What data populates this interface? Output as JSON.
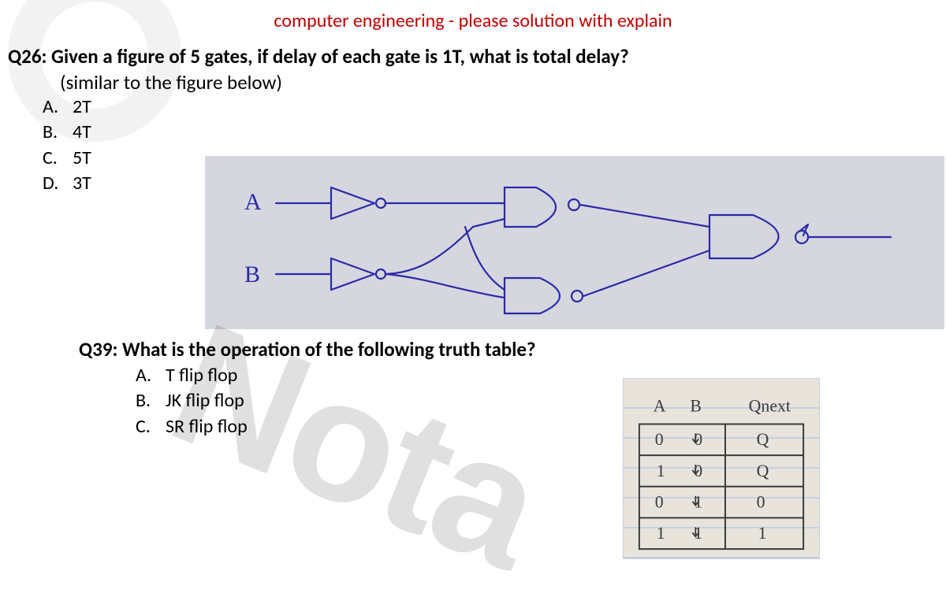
{
  "header": "computer engineering - please solution with explain",
  "q26": {
    "prefix": "Q26:",
    "text": "Given a figure of 5 gates, if delay of each gate is 1T, what is total delay?",
    "subtext": "(similar to the figure below)",
    "choices": [
      {
        "letter": "A.",
        "text": "2T"
      },
      {
        "letter": "B.",
        "text": "4T"
      },
      {
        "letter": "C.",
        "text": "5T"
      },
      {
        "letter": "D.",
        "text": "3T"
      }
    ],
    "inputs": {
      "a": "A",
      "b": "B"
    }
  },
  "q39": {
    "prefix": "Q39:",
    "text": "What is the operation of the following truth table?",
    "choices": [
      {
        "letter": "A.",
        "text": "T flip flop"
      },
      {
        "letter": "B.",
        "text": "JK flip flop"
      },
      {
        "letter": "C.",
        "text": "SR flip flop"
      }
    ],
    "table": {
      "headers": [
        "A",
        "B",
        "Qnext"
      ],
      "rows": [
        [
          "0",
          "0",
          "Q"
        ],
        [
          "1",
          "0",
          "Q"
        ],
        [
          "0",
          "1",
          "0"
        ],
        [
          "1",
          "1",
          "1"
        ]
      ]
    }
  },
  "watermark": "Nota"
}
